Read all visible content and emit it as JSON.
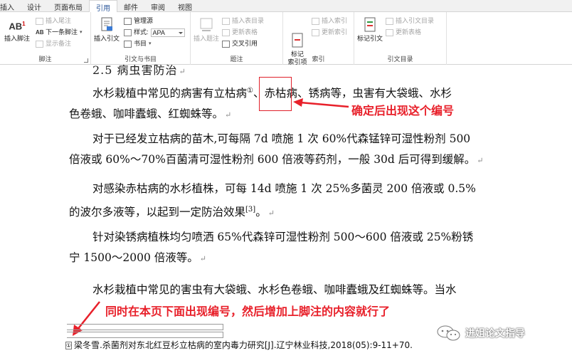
{
  "tabs": [
    {
      "label": "插入",
      "active": false
    },
    {
      "label": "设计",
      "active": false
    },
    {
      "label": "页面布局",
      "active": false
    },
    {
      "label": "引用",
      "active": true
    },
    {
      "label": "邮件",
      "active": false
    },
    {
      "label": "审阅",
      "active": false
    },
    {
      "label": "视图",
      "active": false
    }
  ],
  "ribbon": {
    "footnote_group": {
      "label": "脚注",
      "insert_footnote": "插入脚注",
      "insert_footnote_icon_text": "AB",
      "insert_endnote": "插入尾注",
      "next_footnote": "下一条脚注",
      "show_notes": "显示备注"
    },
    "citation_group": {
      "label": "引文与书目",
      "insert_citation": "插入引文",
      "manage_sources": "管理源",
      "style_label": "样式:",
      "style_value": "APA",
      "bibliography": "书目"
    },
    "caption_group": {
      "label": "题注",
      "insert_caption": "插入题注",
      "insert_table_of_figures": "插入表目录",
      "update_table": "更新表格",
      "cross_reference": "交叉引用"
    },
    "index_group": {
      "label": "索引",
      "mark_entry": "标记\n索引项",
      "insert_index": "插入索引",
      "update_index": "更新索引"
    },
    "toa_group": {
      "label": "引文目录",
      "mark_citation": "标记引文",
      "insert_toa": "插入引文目录",
      "update_table": "更新表格"
    }
  },
  "document": {
    "heading_partial": "2.5 病虫害防治",
    "paragraphs": [
      {
        "line1a": "水杉栽植中常见的病害有立枯病",
        "footnote_ref": "①",
        "line1b": "、赤枯病、锈病等，虫害有大袋蛾、水杉",
        "line2": "色卷蛾、咖啡蠹蛾、红蜘蛛等。"
      },
      {
        "line1": "对于已经发立枯病的苗木,可每隔 7d 喷施 1 次 60%代森锰锌可湿性粉剂 500",
        "line2": "倍液或 60%～70%百菌清可湿性粉剂 600 倍液等药剂，一般 30d 后可得到缓解。"
      },
      {
        "line1": "对感染赤枯病的水杉植株，可每 14d 喷施 1 次 25%多菌灵 200 倍液或 0.5%",
        "line2a": "的波尔多液等，以起到一定防治效果",
        "line2_ref": "[3]",
        "line2b": "。"
      },
      {
        "line1": "针对染锈病植株均匀喷洒 65%代森锌可湿性粉剂 500～600 倍液或 25%粉锈",
        "line2": "宁 1500～2000 倍液等。"
      },
      {
        "line1": "水杉栽植中常见的害虫有大袋蛾、水杉色卷蛾、咖啡蠹蛾及红蜘蛛等。当水"
      }
    ],
    "paragraph_mark": "↵",
    "footnote_text": "梁冬雪.杀菌剂对东北红豆杉立枯病的室内毒力研究[J].辽宁林业科技,2018(05):9-11+70.",
    "footnote_mark": "①"
  },
  "annotations": {
    "top": "确定后出现这个编号",
    "bottom": "同时在本页下面出现编号，然后增加上脚注的内容就行了",
    "color": "#e8202a"
  },
  "watermark": {
    "text": "进姐论文指导"
  }
}
